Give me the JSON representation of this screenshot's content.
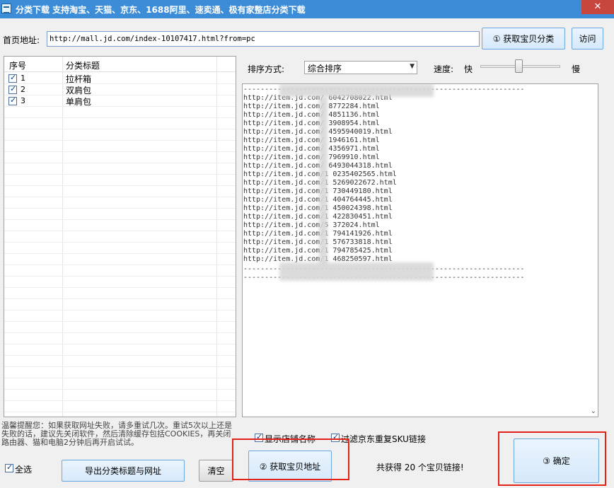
{
  "window": {
    "title": "分类下载    支持淘宝、天猫、京东、1688阿里、速卖通、极有家整店分类下载",
    "close_icon": "✕"
  },
  "header": {
    "homepage_label": "首页地址:",
    "homepage_url": "http://mall.jd.com/index-10107417.html?from=pc",
    "fetch_categories_button": "① 获取宝贝分类",
    "visit_button": "访问"
  },
  "category_list": {
    "columns": [
      "序号",
      "分类标题"
    ],
    "rows": [
      {
        "checked": true,
        "num": "1",
        "title": "拉杆箱"
      },
      {
        "checked": true,
        "num": "2",
        "title": "双肩包"
      },
      {
        "checked": true,
        "num": "3",
        "title": "单肩包"
      }
    ]
  },
  "sort": {
    "label": "排序方式:",
    "selected": "综合排序"
  },
  "speed": {
    "label": "速度:",
    "fast": "快",
    "slow": "慢",
    "level": 0.48
  },
  "log": {
    "separator": "------------------------------------------------------------------",
    "lines": [
      "http://item.jd.com/     6042708022.html",
      "http://item.jd.com/     8772284.html",
      "http://item.jd.com/     4851136.html",
      "http://item.jd.com/     3908954.html",
      "http://item.jd.com/     4595940019.html",
      "http://item.jd.com/     1946161.html",
      "http://item.jd.com/     4356971.html",
      "http://item.jd.com/     7969910.html",
      "http://item.jd.com/     6493044318.html",
      "http://item.jd.com/1    0235402565.html",
      "http://item.jd.com/1    5269022672.html",
      "http://item.jd.com/1    730449180.html",
      "http://item.jd.com/1    404764445.html",
      "http://item.jd.com/1    450024398.html",
      "http://item.jd.com/1    422830451.html",
      "http://item.jd.com/5    372024.html",
      "http://item.jd.com/1    794141926.html",
      "http://item.jd.com/1    576733818.html",
      "http://item.jd.com/1    794785425.html",
      "http://item.jd.com/1    468250597.html"
    ]
  },
  "tip": "温馨提醒您：如果获取网址失败，请多重试几次。重试5次以上还是失败的话，建议先关闭软件，然后清除缓存包括COOKIES，再关闭路由器、猫和电脑2分钟后再开启试试。",
  "options": {
    "show_store_name": "显示店铺名称",
    "show_store_name_checked": true,
    "filter_jd_sku": "过滤京东重复SKU链接",
    "filter_jd_sku_checked": true
  },
  "footer": {
    "select_all": "全选",
    "select_all_checked": true,
    "export_button": "导出分类标题与网址",
    "clear_button": "清空",
    "get_links_button": "② 获取宝贝地址",
    "result_text": "共获得 20 个宝贝链接!",
    "confirm_button": "③ 确定"
  },
  "colors": {
    "titlebar": "#3c8cd8",
    "highlight": "#e3231a",
    "close": "#c7463d"
  }
}
